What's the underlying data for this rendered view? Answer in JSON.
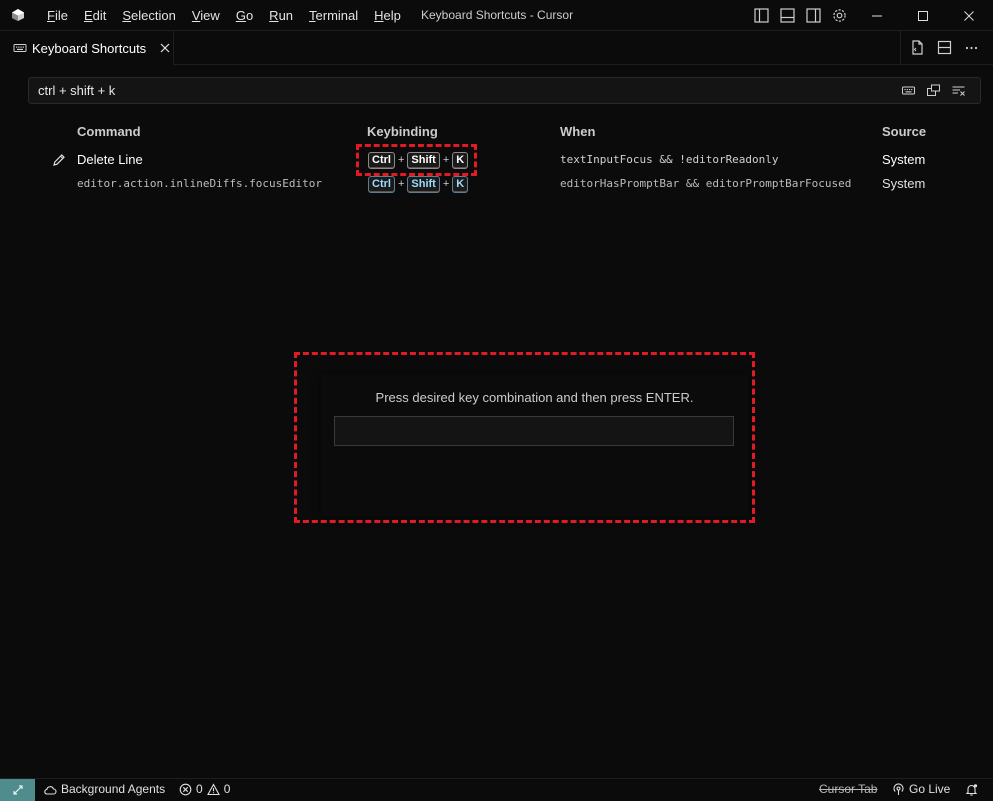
{
  "window": {
    "title": "Keyboard Shortcuts - Cursor",
    "menu": [
      {
        "label": "File",
        "ul": "F",
        "rest": "ile"
      },
      {
        "label": "Edit",
        "ul": "E",
        "rest": "dit"
      },
      {
        "label": "Selection",
        "ul": "S",
        "rest": "election"
      },
      {
        "label": "View",
        "ul": "V",
        "rest": "iew"
      },
      {
        "label": "Go",
        "ul": "G",
        "rest": "o"
      },
      {
        "label": "Run",
        "ul": "R",
        "rest": "un"
      },
      {
        "label": "Terminal",
        "ul": "T",
        "rest": "erminal"
      },
      {
        "label": "Help",
        "ul": "H",
        "rest": "elp"
      }
    ]
  },
  "tab": {
    "label": "Keyboard Shortcuts"
  },
  "search": {
    "value": "ctrl + shift + k"
  },
  "table": {
    "headers": {
      "command": "Command",
      "keybinding": "Keybinding",
      "when": "When",
      "source": "Source"
    },
    "rows": [
      {
        "command": "Delete Line",
        "keys": [
          "Ctrl",
          "Shift",
          "K"
        ],
        "when": "textInputFocus && !editorReadonly",
        "source": "System"
      },
      {
        "command": "editor.action.inlineDiffs.focusEditor",
        "keys": [
          "Ctrl",
          "Shift",
          "K"
        ],
        "when": "editorHasPromptBar && editorPromptBarFocused",
        "source": "System"
      }
    ],
    "plus": "+"
  },
  "dialog": {
    "message": "Press desired key combination and then press ENTER.",
    "input_value": ""
  },
  "statusbar": {
    "background_agents": "Background Agents",
    "errors": "0",
    "warnings": "0",
    "cursor_tab": "Cursor Tab",
    "go_live": "Go Live"
  },
  "colors": {
    "accent": "#4e8c8e",
    "highlight": "#e01b24",
    "key_blue": "#9cdcfe"
  }
}
